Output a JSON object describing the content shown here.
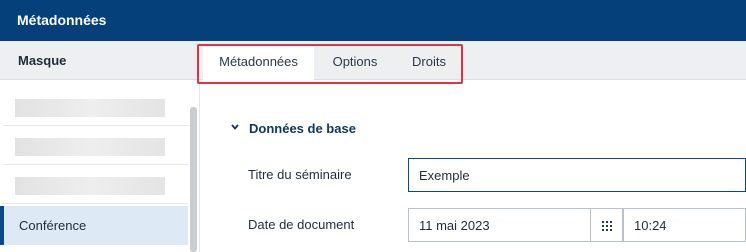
{
  "window": {
    "title": "Métadonnées"
  },
  "sidebar": {
    "header": "Masque",
    "items": [
      {
        "label": "",
        "redacted": true
      },
      {
        "label": "",
        "redacted": true
      },
      {
        "label": "",
        "redacted": true
      },
      {
        "label": "Conférence",
        "active": true
      }
    ]
  },
  "tabs": [
    {
      "label": "Métadonnées",
      "active": true
    },
    {
      "label": "Options",
      "active": false
    },
    {
      "label": "Droits",
      "active": false
    }
  ],
  "section": {
    "title": "Données de base",
    "icon": "chevron-down-icon"
  },
  "fields": {
    "title_label": "Titre du séminaire",
    "title_value": "Exemple",
    "date_label": "Date de document",
    "date_value": "11 mai 2023",
    "time_value": "10:24",
    "calendar_icon": "calendar-grid-icon"
  },
  "colors": {
    "header_bg": "#06407a",
    "highlight": "#dc3545",
    "active_item_bg": "#dde9f4",
    "section_title": "#12365a"
  }
}
